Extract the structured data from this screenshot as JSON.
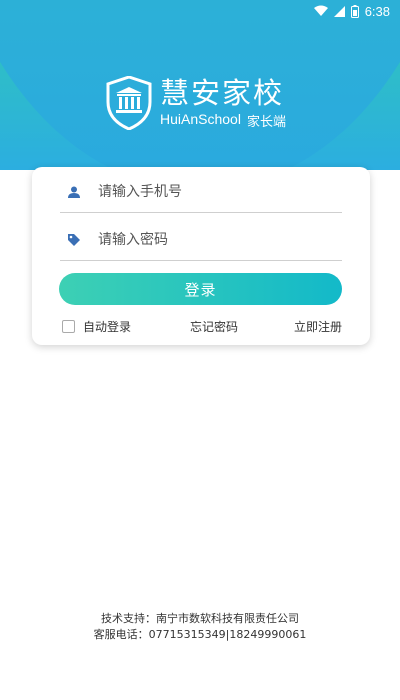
{
  "status_bar": {
    "time": "6:38",
    "icons": [
      "wifi-icon",
      "signal-icon",
      "battery-icon"
    ]
  },
  "brand": {
    "title": "慧安家校",
    "subtitle_en": "HuiAnSchool",
    "subtitle_cn": "家长端",
    "logo_icon": "school-shield-icon"
  },
  "login_form": {
    "phone_placeholder": "请输入手机号",
    "password_placeholder": "请输入密码",
    "phone_icon": "user-icon",
    "password_icon": "tag-icon",
    "login_label": "登录",
    "auto_login_label": "自动登录",
    "forgot_label": "忘记密码",
    "register_label": "立即注册"
  },
  "footer": {
    "support": "技术支持：南宁市数软科技有限责任公司",
    "service": "客服电话：07715315349|18249990061"
  },
  "colors": {
    "accent_start": "#3dd0b4",
    "accent_end": "#13b9c9",
    "header_top": "#2fc7b9",
    "header_bottom": "#2aa9df",
    "icon_blue": "#3a6fb5"
  }
}
